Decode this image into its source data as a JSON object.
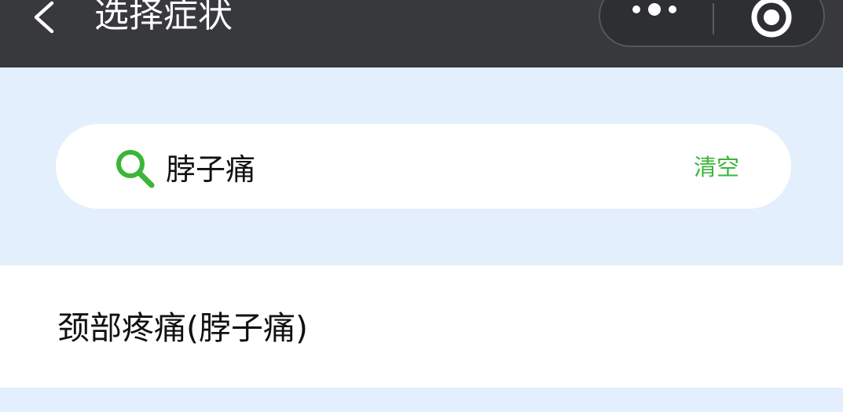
{
  "navbar": {
    "title": "选择症状",
    "back_icon": "chevron-left-icon",
    "more_icon": "more-dots-icon",
    "close_icon": "target-close-icon",
    "background_color": "#38393d"
  },
  "search": {
    "query": "脖子痛",
    "clear_label": "清空",
    "icon": "search-icon",
    "accent_color": "#3bb538"
  },
  "results": [
    {
      "label": "颈部疼痛(脖子痛)"
    }
  ],
  "page_background_color": "#e3effc"
}
